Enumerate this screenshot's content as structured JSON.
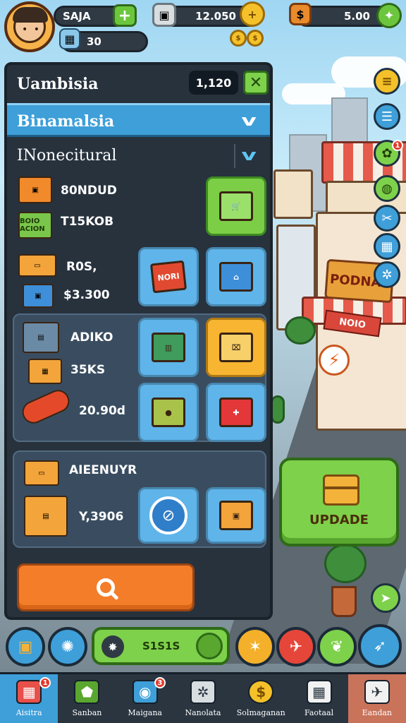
{
  "hud": {
    "player_name": "SAJA",
    "gems": "30",
    "coins": "12.050",
    "cash": "5.00"
  },
  "panel": {
    "title": "Uambisia",
    "value": "1,120",
    "category_selected": "Binamalsia",
    "subcategory_selected": "INonecitural",
    "rows": [
      {
        "label": "80NDUD",
        "icon_label": ""
      },
      {
        "label": "T15KOB",
        "icon_label": "BOIO ACION"
      },
      {
        "label": "R0S,",
        "icon_label": ""
      },
      {
        "label": "$3.300",
        "icon_label": ""
      }
    ],
    "section1_rows": [
      {
        "label": "ADIKO"
      },
      {
        "label": "35KS"
      },
      {
        "label": "20.90d"
      }
    ],
    "section2_title": "AIEENUYR",
    "section2_value": "Y,3906",
    "tile_sign_text": "NORI"
  },
  "update_button": {
    "label": "UPDADE"
  },
  "shop_sign": {
    "main": "PODNAL",
    "sub": "NOIO"
  },
  "action_bar": {
    "value": "S1S1S"
  },
  "notifications": {
    "side_badge": "1",
    "nav_first": "1",
    "nav_magazine": "3"
  },
  "nav": [
    {
      "label": "Aisitra",
      "icon": "basket-icon"
    },
    {
      "label": "Sanban",
      "icon": "shield-icon"
    },
    {
      "label": "Maigana",
      "icon": "camera-icon"
    },
    {
      "label": "Nanolata",
      "icon": "gear-icon"
    },
    {
      "label": "Solmaganan",
      "icon": "coin-icon"
    },
    {
      "label": "Faotaal",
      "icon": "grid-icon"
    },
    {
      "label": "Eandan",
      "icon": "plane-icon"
    }
  ],
  "colors": {
    "panel": "#27323d",
    "accent_blue": "#3e9fd9",
    "accent_green": "#7ed14a",
    "accent_orange": "#f47d2a"
  }
}
